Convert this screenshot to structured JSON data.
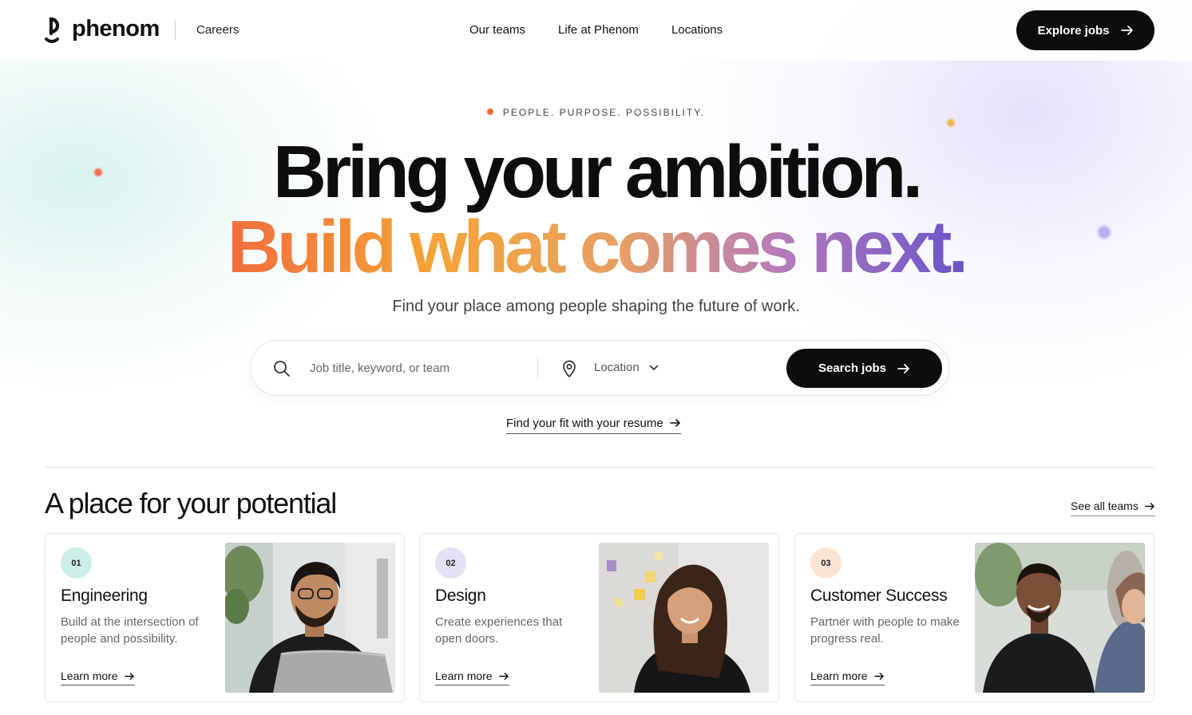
{
  "header": {
    "logo_text": "phenom",
    "section_label": "Careers",
    "nav": [
      "Our teams",
      "Life at Phenom",
      "Locations"
    ],
    "cta_label": "Explore jobs"
  },
  "hero": {
    "eyebrow": "PEOPLE. PURPOSE. POSSIBILITY.",
    "headline_line1": "Bring your ambition.",
    "headline_line2": "Build what comes next.",
    "subhead": "Find your place among people shaping the future of work.",
    "gradient_colors": [
      "#f26d3d",
      "#f5a335",
      "#e8a062",
      "#b57bb8",
      "#6a55c8"
    ]
  },
  "search": {
    "keyword_placeholder": "Job title, keyword, or team",
    "location_label": "Location",
    "button_label": "Search jobs"
  },
  "resume_link": "Find your fit with your resume",
  "teams_section": {
    "title": "A place for your potential",
    "see_all_label": "See all teams",
    "cards": [
      {
        "number": "01",
        "title": "Engineering",
        "description": "Build at the intersection of people and possibility.",
        "link_label": "Learn more",
        "badge_color": "#cdeee7"
      },
      {
        "number": "02",
        "title": "Design",
        "description": "Create experiences that open doors.",
        "link_label": "Learn more",
        "badge_color": "#e4e0f6"
      },
      {
        "number": "03",
        "title": "Customer Success",
        "description": "Partner with people to make progress real.",
        "link_label": "Learn more",
        "badge_color": "#fbe4d3"
      }
    ]
  }
}
